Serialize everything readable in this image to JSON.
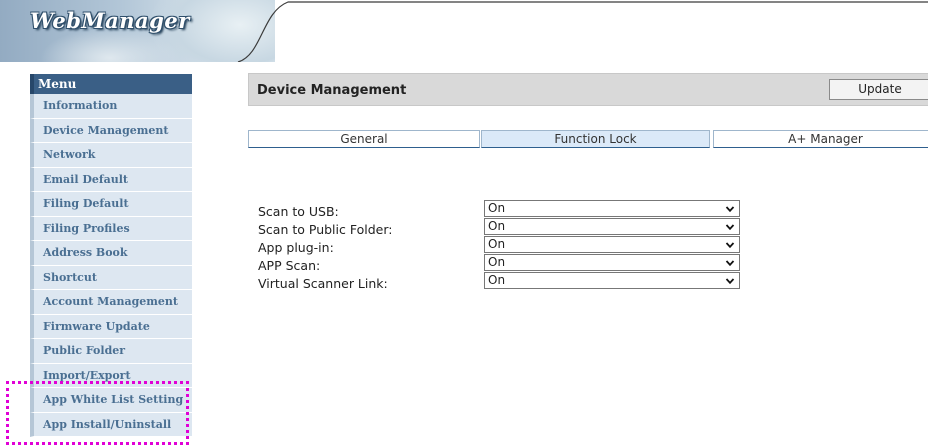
{
  "app": {
    "logo_text": "WebManager"
  },
  "menu": {
    "header": "Menu",
    "items": [
      "Information",
      "Device Management",
      "Network",
      "Email Default",
      "Filing Default",
      "Filing Profiles",
      "Address Book",
      "Shortcut",
      "Account Management",
      "Firmware Update",
      "Public Folder",
      "Import/Export",
      "App White List Setting",
      "App Install/Uninstall"
    ]
  },
  "main": {
    "title": "Device Management",
    "update_label": "Update",
    "tabs": [
      {
        "label": "General",
        "active": false
      },
      {
        "label": "Function Lock",
        "active": true
      },
      {
        "label": "A+ Manager",
        "active": false
      }
    ],
    "settings": [
      {
        "label": "Scan to USB:",
        "value": "On"
      },
      {
        "label": "Scan to Public Folder:",
        "value": "On"
      },
      {
        "label": "App plug-in:",
        "value": "On"
      },
      {
        "label": "APP Scan:",
        "value": "On"
      },
      {
        "label": "Virtual Scanner Link:",
        "value": "On"
      }
    ]
  },
  "colors": {
    "menu_header_bg": "#3a5f86",
    "menu_item_bg": "#dde7f1",
    "menu_item_text": "#4a6f92",
    "active_tab_bg": "#dbe9f8",
    "highlight_border": "#e000d6"
  },
  "icons": {
    "dropdown": "chevron-down-icon"
  }
}
